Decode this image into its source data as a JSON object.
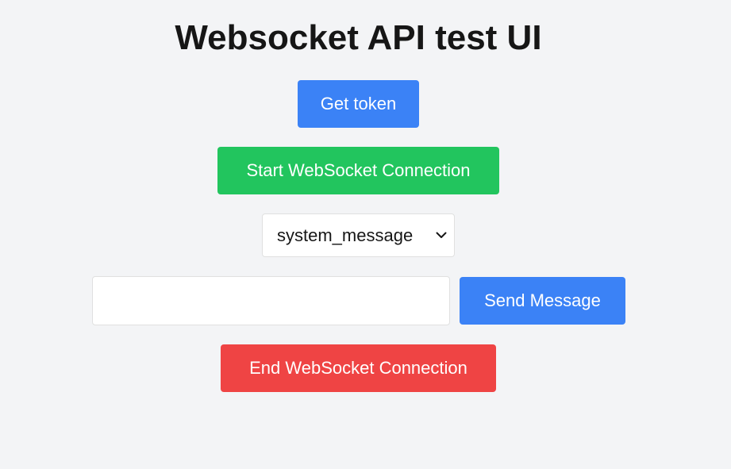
{
  "page": {
    "title": "Websocket API test UI"
  },
  "buttons": {
    "get_token": "Get token",
    "start_connection": "Start WebSocket Connection",
    "send_message": "Send Message",
    "end_connection": "End WebSocket Connection"
  },
  "message_type_select": {
    "selected": "system_message",
    "icon": "chevron-down-icon"
  },
  "message_input": {
    "value": "",
    "placeholder": ""
  },
  "colors": {
    "background": "#f3f4f6",
    "primary_blue": "#3b82f6",
    "success_green": "#22c55e",
    "danger_red": "#ef4444"
  }
}
